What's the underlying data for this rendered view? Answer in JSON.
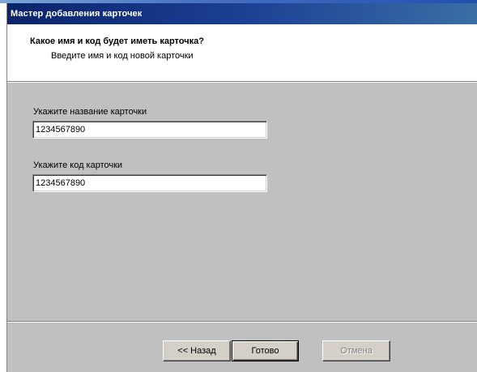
{
  "window": {
    "title": "Мастер добавления карточек"
  },
  "header": {
    "title": "Какое имя и код будет иметь карточка?",
    "subtitle": "Введите имя и код новой карточки"
  },
  "form": {
    "name_label": "Укажите название карточки",
    "name_value": "1234567890",
    "code_label": "Укажите код карточки",
    "code_value": "1234567890"
  },
  "buttons": {
    "back": "<< Назад",
    "finish": "Готово",
    "cancel": "Отмена",
    "cancel_disabled": true
  }
}
